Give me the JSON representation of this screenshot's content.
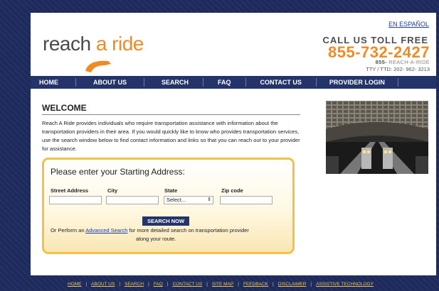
{
  "header": {
    "logo_parts": [
      "reach ",
      "a",
      " ride"
    ],
    "lang_link": "EN ESPAÑOL",
    "call_us": "CALL US TOLL FREE",
    "phone": "855-732-2427",
    "phone_alt_prefix": "855-",
    "phone_alt_rest": " REACH-A-RIDE",
    "tty": "TTY / TTD: 202- 962- 3213"
  },
  "nav": {
    "items": [
      "HOME",
      "ABOUT US",
      "SEARCH",
      "FAQ",
      "CONTACT US",
      "PROVIDER LOGIN"
    ]
  },
  "welcome": {
    "title": "WELCOME",
    "text": "Reach A Ride provides individuals who require transportation assistance with information about the transportation providers in their area. If you would quickly like to know who provides transportation services, use the search window below to find contact information and links so that you can reach out to your provider for assistance."
  },
  "search": {
    "title": "Please enter your Starting Address:",
    "street_label": "Street Address",
    "city_label": "City",
    "state_label": "State",
    "zip_label": "Zip code",
    "state_selected": "Select...",
    "button": "SEARCH NOW",
    "adv_prefix": "Or Perform an ",
    "adv_link": "Advanced Search",
    "adv_suffix": " for more detailed search on transportation provider",
    "adv_line2": "along your route."
  },
  "footer": {
    "links": [
      "HOME",
      "ABOUT US",
      "SEARCH",
      "FAQ",
      "CONTACT US",
      "SITE MAP",
      "FEEDBACK",
      "DISCLAIMER",
      "ASSISTIVE TECHNOLOGY"
    ]
  },
  "colors": {
    "background": "#1d2a5c",
    "nav": "#24346b",
    "accent_orange": "#f08a24",
    "accent_gold": "#f0c24a"
  }
}
